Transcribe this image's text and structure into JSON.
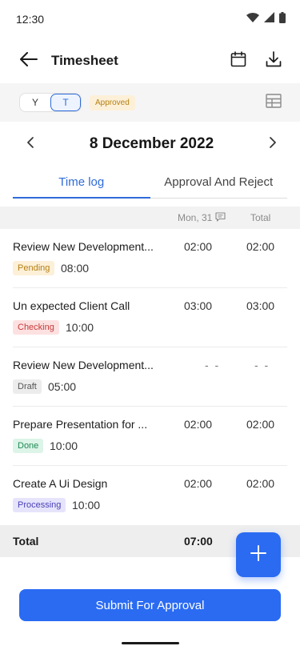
{
  "status_bar": {
    "time": "12:30"
  },
  "app_bar": {
    "title": "Timesheet"
  },
  "filter": {
    "segments": [
      "Y",
      "T"
    ],
    "active_segment": "T",
    "badge": "Approved"
  },
  "date_nav": {
    "date": "8 December 2022"
  },
  "tabs": [
    {
      "label": "Time log",
      "active": true
    },
    {
      "label": "Approval And Reject",
      "active": false
    }
  ],
  "table_head": {
    "day": "Mon, 31",
    "total": "Total"
  },
  "entries": [
    {
      "title": "Review New Development...",
      "status": "Pending",
      "time": "08:00",
      "day": "02:00",
      "total": "02:00"
    },
    {
      "title": "Un expected Client Call",
      "status": "Checking",
      "time": "10:00",
      "day": "03:00",
      "total": "03:00"
    },
    {
      "title": "Review New Development...",
      "status": "Draft",
      "time": "05:00",
      "day": "- -",
      "total": "- -"
    },
    {
      "title": "Prepare Presentation for ...",
      "status": "Done",
      "time": "10:00",
      "day": "02:00",
      "total": "02:00"
    },
    {
      "title": "Create A Ui Design",
      "status": "Processing",
      "time": "10:00",
      "day": "02:00",
      "total": "02:00"
    }
  ],
  "status_colors": {
    "Pending": {
      "bg": "#fdf0d8",
      "fg": "#b57f14"
    },
    "Checking": {
      "bg": "#fde1e1",
      "fg": "#c73a3a"
    },
    "Draft": {
      "bg": "#ececec",
      "fg": "#555555"
    },
    "Done": {
      "bg": "#ddf4e8",
      "fg": "#1f8a55"
    },
    "Processing": {
      "bg": "#e6e4fb",
      "fg": "#4b41b8"
    }
  },
  "total_bar": {
    "label": "Total",
    "value": "07:00"
  },
  "submit": {
    "label": "Submit For Approval"
  },
  "accent_color": "#2a6bf2",
  "icons": [
    "wifi-icon",
    "signal-icon",
    "battery-icon",
    "back-arrow-icon",
    "calendar-icon",
    "download-icon",
    "table-view-icon",
    "chevron-left-icon",
    "chevron-right-icon",
    "comment-icon",
    "plus-icon"
  ]
}
